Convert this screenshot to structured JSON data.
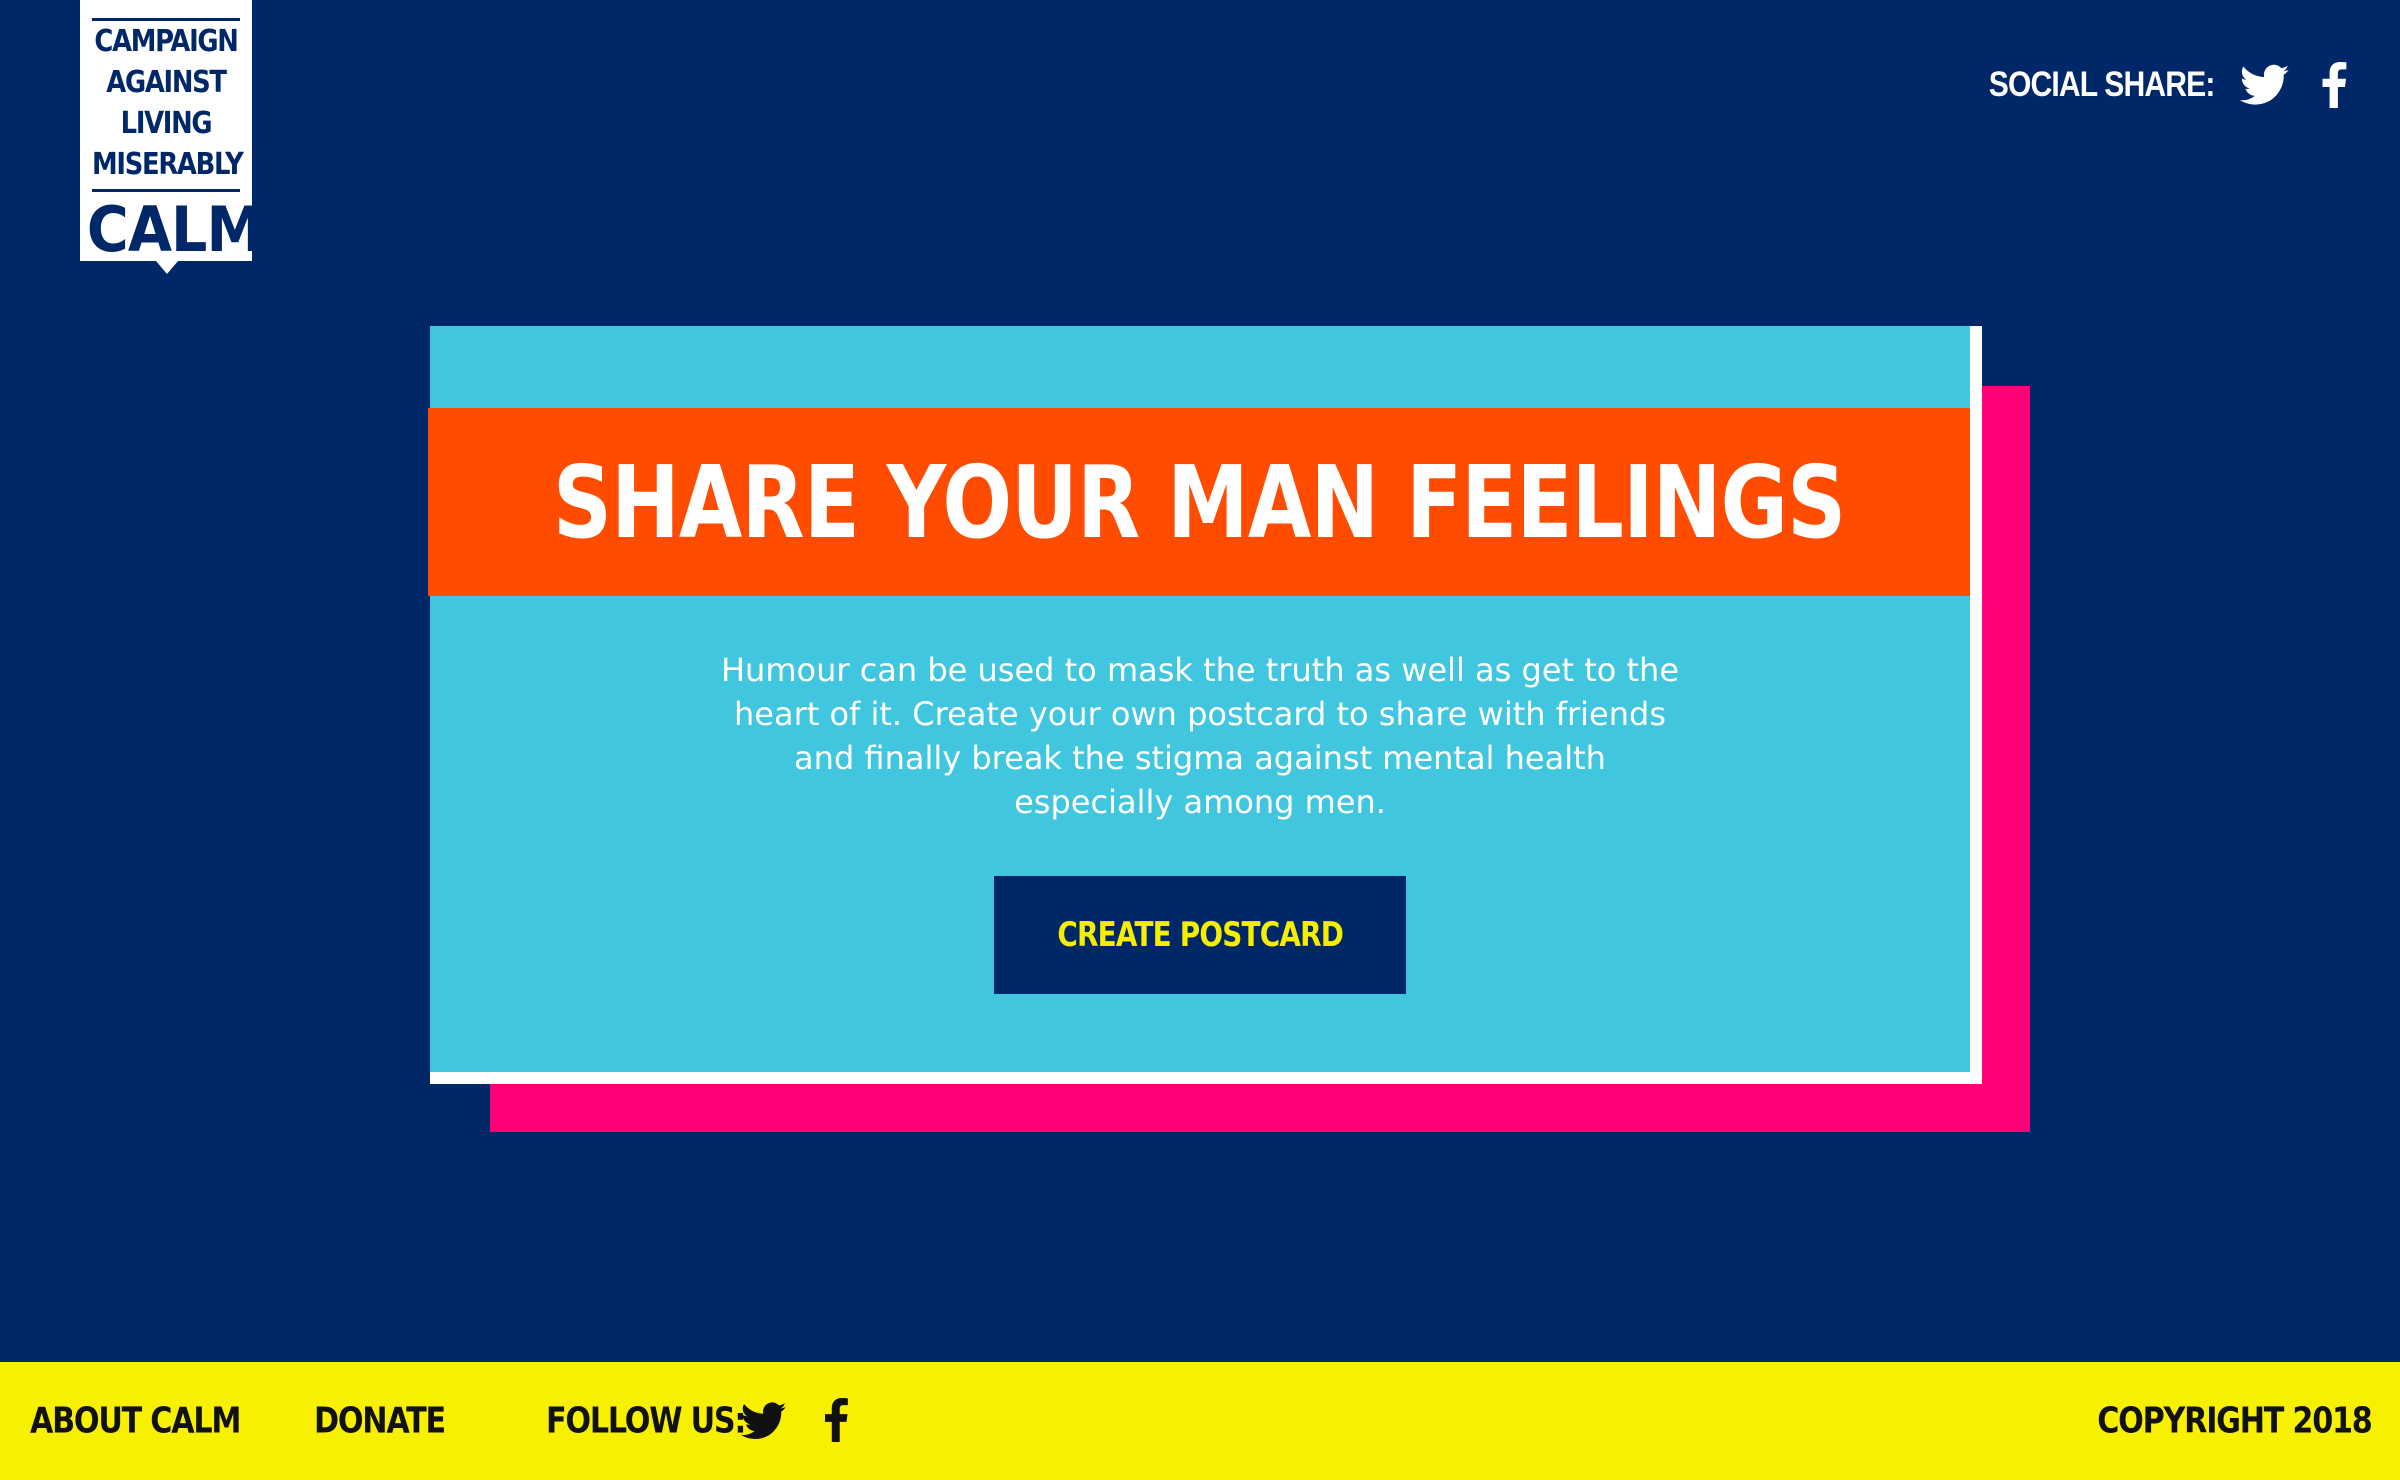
{
  "logo": {
    "lines": [
      "CAMPAIGN",
      "AGAINST",
      "LIVING",
      "MISERABLY"
    ],
    "acronym": "CALM"
  },
  "header": {
    "social_share_label": "SOCIAL SHARE:",
    "icons": [
      "twitter-icon",
      "facebook-icon"
    ]
  },
  "card": {
    "title": "SHARE YOUR MAN FEELINGS",
    "description": "Humour can be used to mask the truth as well as get to the heart of it. Create your own postcard to share with friends and finally break the stigma against mental health especially among men.",
    "cta_label": "CREATE POSTCARD"
  },
  "footer": {
    "about_label": "ABOUT CALM",
    "donate_label": "DONATE",
    "follow_label": "FOLLOW US:",
    "copyright": "COPYRIGHT 2018",
    "icons": [
      "twitter-icon",
      "facebook-icon"
    ]
  },
  "colors": {
    "background": "#002767",
    "card": "#40c7df",
    "banner": "#ff4c00",
    "card_shadow": "#ff0077",
    "footer": "#f7f000",
    "cta_text": "#f5ee00"
  }
}
